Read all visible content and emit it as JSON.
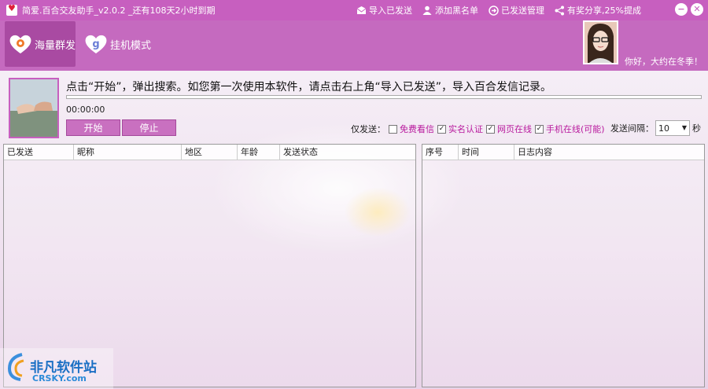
{
  "window": {
    "title": "简爱.百合交友助手_v2.0.2 _还有108天2小时到期",
    "minimize": "−",
    "close": "✕"
  },
  "top_actions": [
    {
      "label": "导入已发送",
      "icon": "mail-icon"
    },
    {
      "label": "添加黑名单",
      "icon": "person-icon"
    },
    {
      "label": "已发送管理",
      "icon": "arrow-circle-icon"
    },
    {
      "label": "有奖分享,25%提成",
      "icon": "share-icon"
    }
  ],
  "modes": [
    {
      "label": "海量群发",
      "icon": "heart-icon",
      "active": true
    },
    {
      "label": "挂机模式",
      "icon": "g-heart-icon",
      "active": false
    }
  ],
  "user": {
    "greeting": "你好，大约在冬季！"
  },
  "task": {
    "instruction": "点击“开始”，弹出搜索。如您第一次使用本软件，请点击右上角“导入已发送”，导入百合发信记录。",
    "timer": "00:00:00",
    "progress": 0,
    "start_label": "开始",
    "stop_label": "停止"
  },
  "filters": {
    "label": "仅发送：",
    "options": [
      {
        "label": "免费看信",
        "checked": false
      },
      {
        "label": "实名认证",
        "checked": true
      },
      {
        "label": "网页在线",
        "checked": true
      },
      {
        "label": "手机在线(可能)",
        "checked": true
      }
    ],
    "interval_label": "发送间隔：",
    "interval_value": "10",
    "interval_unit": "秒"
  },
  "left_table": {
    "columns": [
      "已发送",
      "昵称",
      "地区",
      "年龄",
      "发送状态"
    ]
  },
  "right_table": {
    "columns": [
      "序号",
      "时间",
      "日志内容"
    ]
  },
  "watermark": {
    "title": "非凡软件站",
    "subtitle": "CRSKY.com"
  },
  "colors": {
    "accent": "#c75fbf",
    "option_text": "#b8189d"
  }
}
